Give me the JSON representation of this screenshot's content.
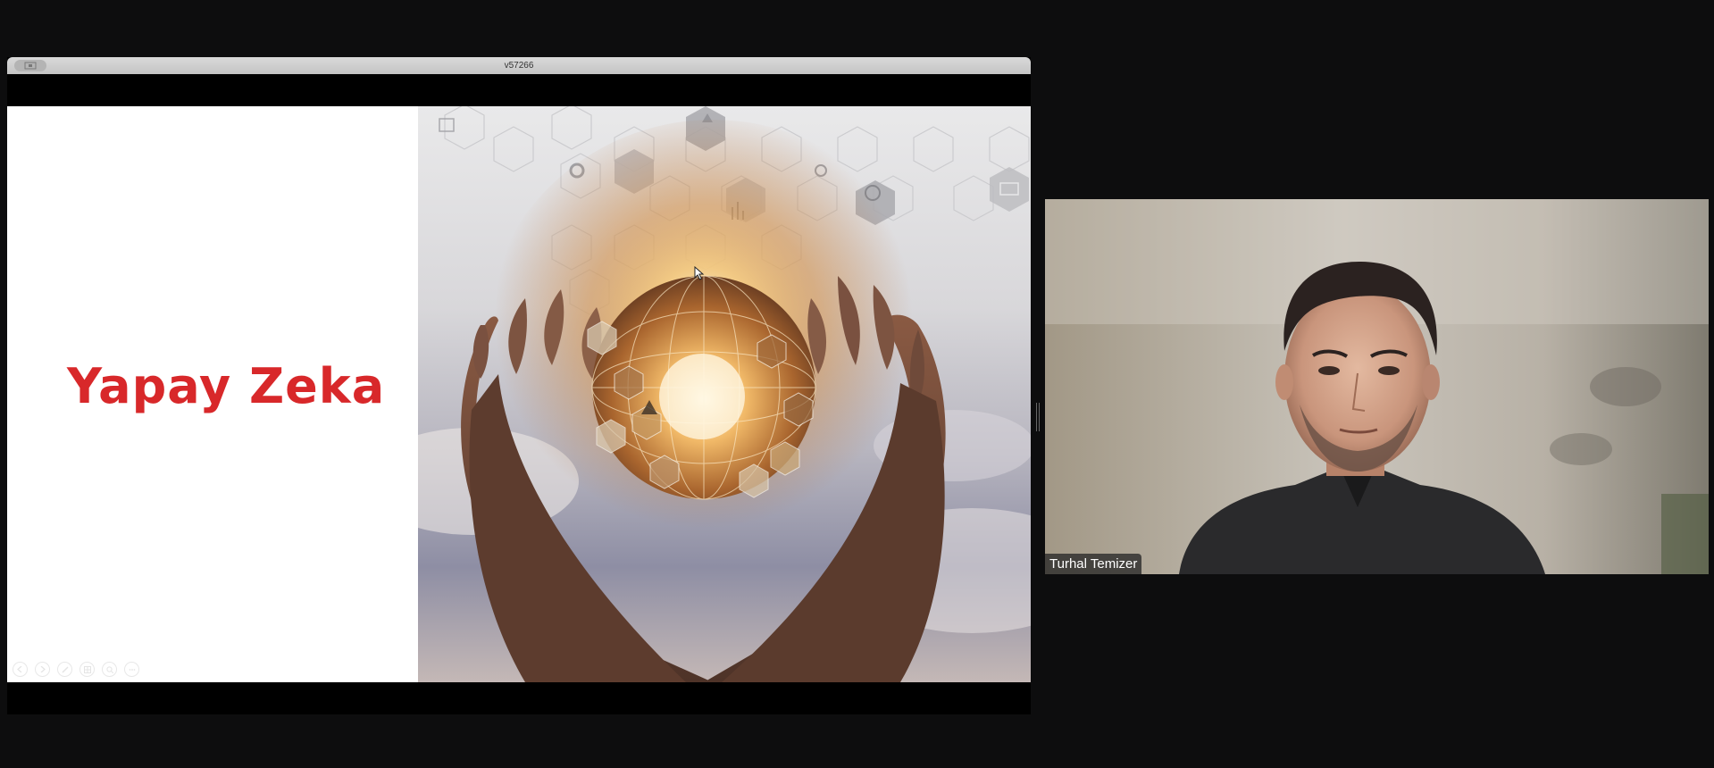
{
  "share_window": {
    "title": "v57266",
    "icon": "screen-share-icon"
  },
  "slide": {
    "title": "Yapay Zeka",
    "title_color": "#d8282a",
    "image": "hands-holding-glowing-globe",
    "controls": [
      "prev-icon",
      "next-icon",
      "pen-icon",
      "grid-icon",
      "zoom-icon",
      "more-icon"
    ]
  },
  "participant": {
    "name": "Turhal Temizer"
  },
  "colors": {
    "background": "#0d0d0e",
    "accent": "#d8282a"
  }
}
